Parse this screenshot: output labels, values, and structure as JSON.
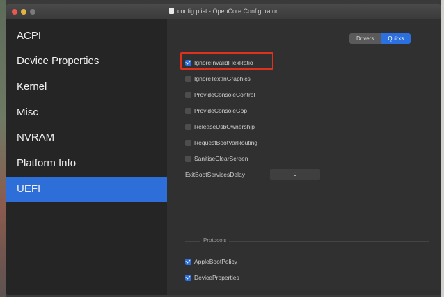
{
  "window": {
    "title": "config.plist - OpenCore Configurator"
  },
  "sidebar": {
    "items": [
      {
        "label": "ACPI"
      },
      {
        "label": "Device Properties"
      },
      {
        "label": "Kernel"
      },
      {
        "label": "Misc"
      },
      {
        "label": "NVRAM"
      },
      {
        "label": "Platform Info"
      },
      {
        "label": "UEFI",
        "selected": true
      }
    ]
  },
  "tabs": [
    {
      "label": "Drivers"
    },
    {
      "label": "Quirks",
      "active": true
    }
  ],
  "quirks": [
    {
      "label": "IgnoreInvalidFlexRatio",
      "checked": true
    },
    {
      "label": "IgnoreTextInGraphics",
      "checked": false
    },
    {
      "label": "ProvideConsoleControl",
      "checked": false
    },
    {
      "label": "ProvideConsoleGop",
      "checked": false
    },
    {
      "label": "ReleaseUsbOwnership",
      "checked": false
    },
    {
      "label": "RequestBootVarRouting",
      "checked": false
    },
    {
      "label": "SanitiseClearScreen",
      "checked": false
    }
  ],
  "exit_boot_services_delay": {
    "label": "ExitBootServicesDelay",
    "value": "0"
  },
  "protocols": {
    "section_label": "Protocols",
    "items": [
      {
        "label": "AppleBootPolicy",
        "checked": true
      },
      {
        "label": "DeviceProperties",
        "checked": true
      }
    ]
  },
  "colors": {
    "accent": "#2c6fde",
    "highlight_box": "#e0301e",
    "sidebar_bg": "#252525",
    "content_bg": "#303030"
  }
}
